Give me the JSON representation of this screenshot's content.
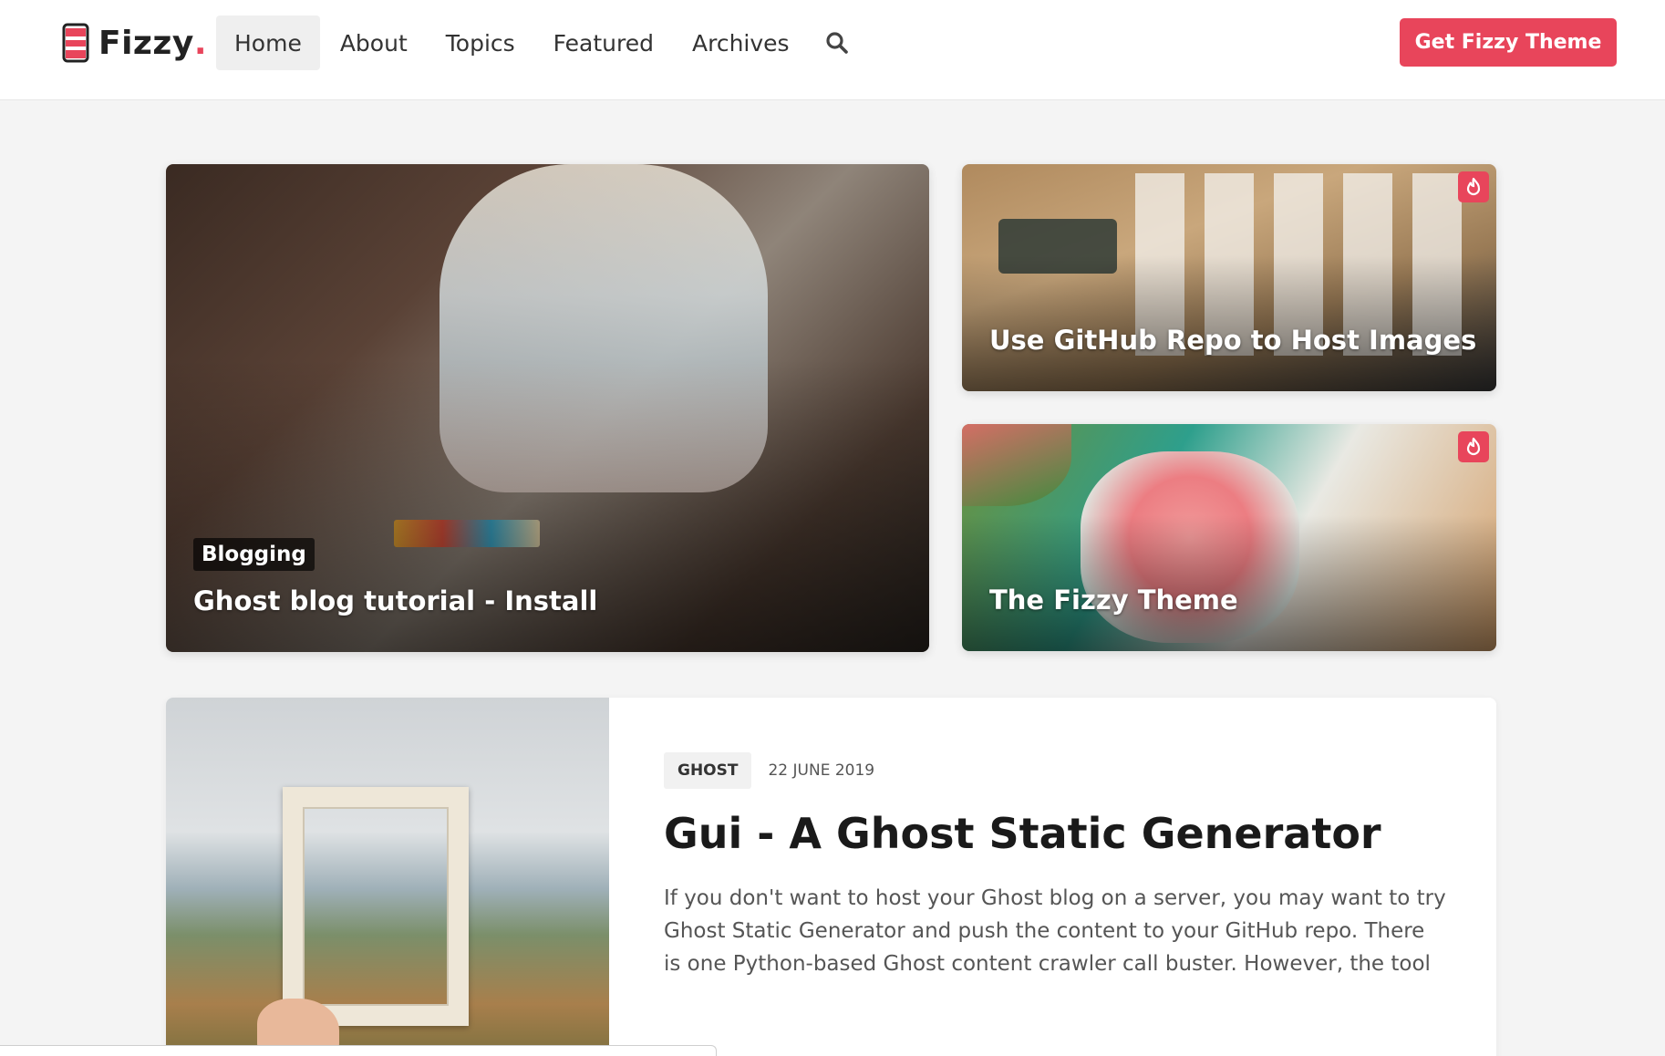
{
  "brand": {
    "name": "Fizzy",
    "dot": ".",
    "accent": "#e8455b"
  },
  "nav": {
    "items": [
      {
        "label": "Home",
        "active": true
      },
      {
        "label": "About",
        "active": false
      },
      {
        "label": "Topics",
        "active": false
      },
      {
        "label": "Featured",
        "active": false
      },
      {
        "label": "Archives",
        "active": false
      }
    ],
    "search_icon": "search-icon"
  },
  "cta": {
    "label": "Get Fizzy Theme"
  },
  "featured": {
    "big": {
      "tag": "Blogging",
      "title": "Ghost blog tutorial - Install"
    },
    "small": [
      {
        "title": "Use GitHub Repo to Host Images",
        "badge_icon": "fire-icon"
      },
      {
        "title": "The Fizzy Theme",
        "badge_icon": "fire-icon"
      }
    ]
  },
  "post": {
    "category": "GHOST",
    "date": "22 JUNE 2019",
    "title": "Gui - A Ghost Static Generator",
    "excerpt": "If you don't want to host your Ghost blog on a server, you may want to try Ghost Static Generator and push the content to your GitHub repo. There is one Python-based Ghost content crawler call buster. However, the tool"
  }
}
